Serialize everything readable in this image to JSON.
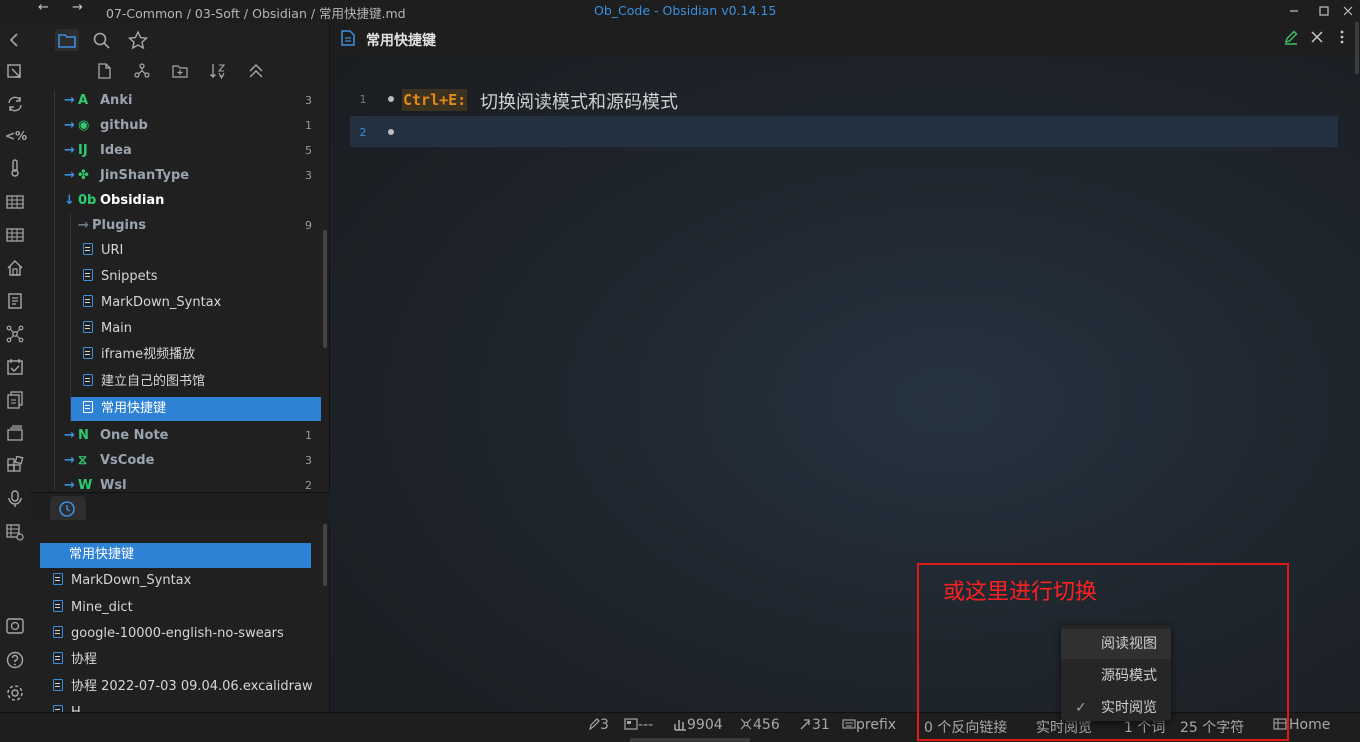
{
  "titlebar": {
    "back": "←",
    "forward": "→",
    "path": "07-Common / 03-Soft / Obsidian / 常用快捷键.md",
    "app_title": "Ob_Code - Obsidian v0.14.15"
  },
  "tree": {
    "folders_top": [
      {
        "name": "Anki",
        "count": "3",
        "icon": "anki-icon",
        "icon_glyph": "A",
        "icon_color": "#2ecc71"
      },
      {
        "name": "github",
        "count": "1",
        "icon": "github-icon",
        "icon_glyph": "◉",
        "icon_color": "#2ecc71"
      },
      {
        "name": "Idea",
        "count": "5",
        "icon": "idea-icon",
        "icon_glyph": "IJ",
        "icon_color": "#2ecc71"
      },
      {
        "name": "JinShanType",
        "count": "3",
        "icon": "jinshan-icon",
        "icon_glyph": "✤",
        "icon_color": "#2ecc71"
      }
    ],
    "open_folder": {
      "name": "Obsidian",
      "icon_glyph": "0b",
      "icon_color": "#2ecc71"
    },
    "subfolder": {
      "name": "Plugins",
      "count": "9"
    },
    "files": [
      "URI",
      "Snippets",
      "MarkDown_Syntax",
      "Main",
      "iframe视频播放",
      "建立自己的图书馆",
      "常用快捷键"
    ],
    "folders_bottom": [
      {
        "name": "One Note",
        "count": "1",
        "icon": "onenote-icon",
        "icon_glyph": "N",
        "icon_color": "#2ecc71"
      },
      {
        "name": "VsCode",
        "count": "3",
        "icon": "vscode-icon",
        "icon_glyph": "⧖",
        "icon_color": "#2ecc71"
      },
      {
        "name": "Wsl",
        "count": "2",
        "icon": "wsl-icon",
        "icon_glyph": "W",
        "icon_color": "#2ecc71"
      }
    ]
  },
  "recent": {
    "items": [
      "常用快捷键",
      "MarkDown_Syntax",
      "Mine_dict",
      "google-10000-english-no-swears",
      "协程",
      "协程 2022-07-03 09.04.06.excalidraw",
      "H..."
    ]
  },
  "editor": {
    "title": "常用快捷键",
    "line_numbers": [
      "1",
      "2"
    ],
    "code": "Ctrl+E:",
    "text": "切换阅读模式和源码模式"
  },
  "statusbar": {
    "sync": "3",
    "dash": "---",
    "words": "9904",
    "nodes": "456",
    "links": "31",
    "prefix": "prefix",
    "backlinks": "0 个反向链接",
    "mode": "实时阅览",
    "lines": "1 个词",
    "chars": "25 个字符",
    "home": "Home"
  },
  "menu": {
    "items": [
      "阅读视图",
      "源码模式",
      "实时阅览"
    ],
    "checked": "✓"
  },
  "annotation": {
    "text": "或这里进行切换",
    "color": "#e01818"
  }
}
